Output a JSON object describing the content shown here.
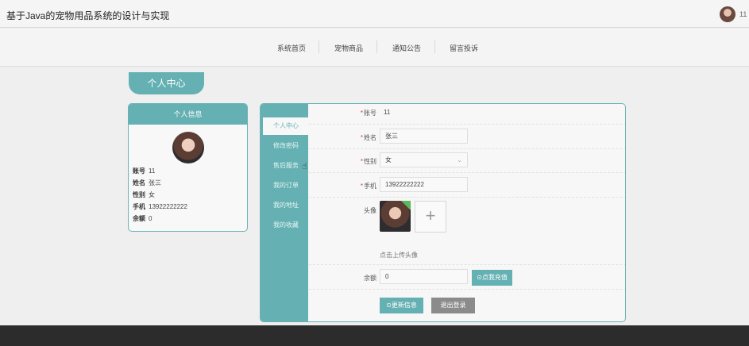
{
  "header": {
    "title": "基于Java的宠物用品系统的设计与实现",
    "user_name": "11",
    "avatar_icon": "user-avatar"
  },
  "nav": {
    "items": [
      {
        "label": "系统首页"
      },
      {
        "label": "宠物商品"
      },
      {
        "label": "通知公告"
      },
      {
        "label": "留言投诉"
      }
    ]
  },
  "page_tab": "个人中心",
  "info_card": {
    "title": "个人信息",
    "rows": [
      {
        "label": "账号",
        "value": "11"
      },
      {
        "label": "姓名",
        "value": "张三"
      },
      {
        "label": "性别",
        "value": "女"
      },
      {
        "label": "手机",
        "value": "13922222222"
      },
      {
        "label": "余额",
        "value": "0"
      }
    ]
  },
  "side_menu": {
    "items": [
      {
        "label": "个人中心",
        "active": true
      },
      {
        "label": "修改密码",
        "active": false
      },
      {
        "label": "售后服务",
        "active": false
      },
      {
        "label": "我的订单",
        "active": false
      },
      {
        "label": "我的地址",
        "active": false
      },
      {
        "label": "我的收藏",
        "active": false
      }
    ]
  },
  "form": {
    "account_label": "账号",
    "account_value": "11",
    "name_label": "姓名",
    "name_value": "张三",
    "gender_label": "性别",
    "gender_value": "女",
    "phone_label": "手机",
    "phone_value": "13922222222",
    "avatar_label": "头像",
    "upload_plus": "+",
    "upload_hint": "点击上传头像",
    "balance_label": "余额",
    "balance_value": "0",
    "recharge_button": "⊙点我充值",
    "update_button": "⊙更新信息",
    "logout_button": "退出登录"
  },
  "colors": {
    "accent": "#64b0b2",
    "footer": "#2c2c2c",
    "logout_button": "#8b8b8b"
  }
}
